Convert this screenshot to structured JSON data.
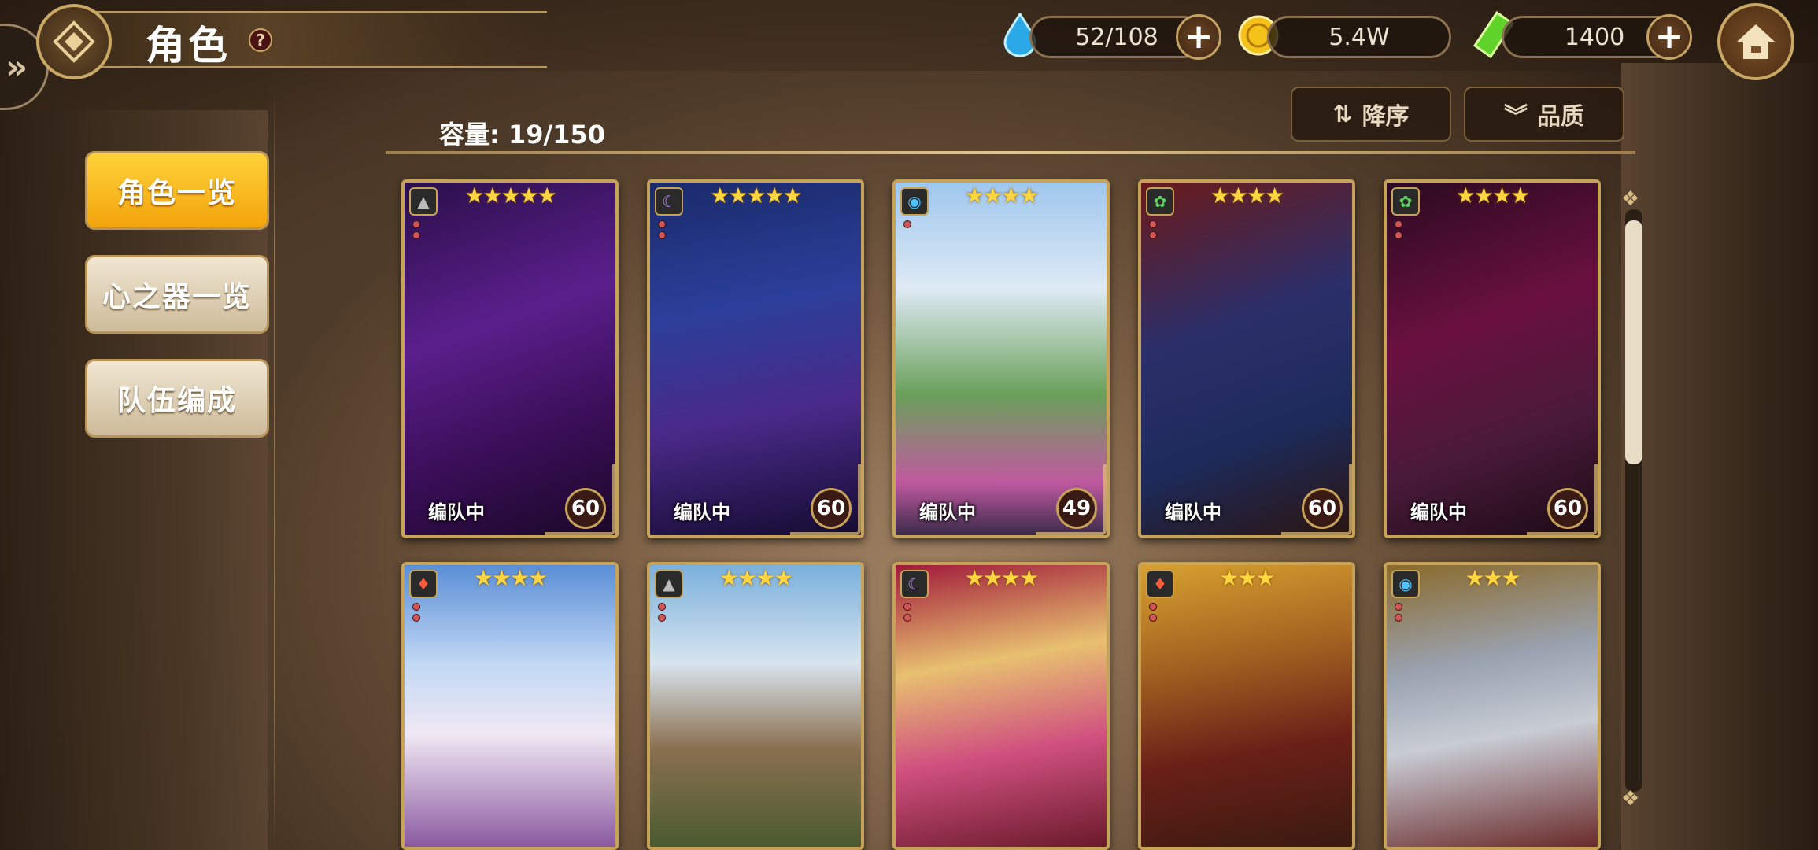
{
  "header": {
    "title": "角色",
    "help": "?"
  },
  "currency": {
    "stamina": "52/108",
    "gold": "5.4W",
    "gems": "1400",
    "plus": "+"
  },
  "sort": {
    "order_label": "降序",
    "order_icon": "⇅",
    "filter_label": "品质",
    "filter_icon": "︾"
  },
  "capacity": "容量: 19/150",
  "sidebar": {
    "items": [
      {
        "label": "角色一览"
      },
      {
        "label": "心之器一览"
      },
      {
        "label": "队伍编成"
      }
    ]
  },
  "cards": [
    {
      "stars": "★★★★★",
      "status": "编队中",
      "level": "60"
    },
    {
      "stars": "★★★★★",
      "status": "编队中",
      "level": "60"
    },
    {
      "stars": "★★★★",
      "status": "编队中",
      "level": "49"
    },
    {
      "stars": "★★★★",
      "status": "编队中",
      "level": "60"
    },
    {
      "stars": "★★★★",
      "status": "编队中",
      "level": "60"
    },
    {
      "stars": "★★★★",
      "status": "",
      "level": ""
    },
    {
      "stars": "★★★★",
      "status": "",
      "level": ""
    },
    {
      "stars": "★★★★",
      "status": "",
      "level": ""
    },
    {
      "stars": "★★★",
      "status": "",
      "level": ""
    },
    {
      "stars": "★★★",
      "status": "",
      "level": ""
    }
  ],
  "colors": {
    "gold": "#c7a35a",
    "active_tab": "#f3a40c",
    "star": "#ffd640"
  }
}
